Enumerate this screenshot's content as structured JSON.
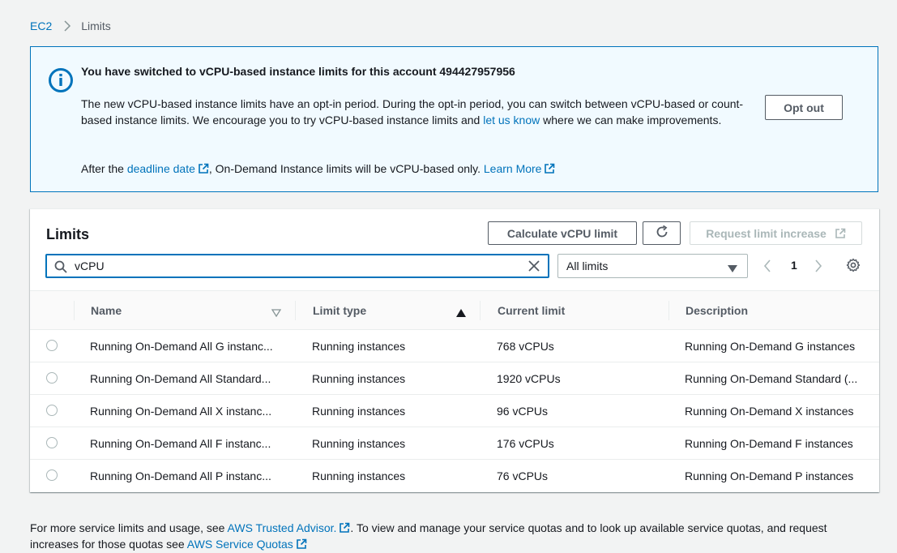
{
  "breadcrumb": {
    "root": "EC2",
    "current": "Limits"
  },
  "banner": {
    "title": "You have switched to vCPU-based instance limits for this account 494427957956",
    "body_part1": "The new vCPU-based instance limits have an opt-in period. During the opt-in period, you can switch between vCPU-based or count-based instance limits. We encourage you to try vCPU-based instance limits and ",
    "body_link": "let us know",
    "body_part2": " where we can make improvements.",
    "foot_part1": "After the ",
    "foot_link1": "deadline date",
    "foot_part2": ", On-Demand Instance limits will be vCPU-based only. ",
    "foot_link2": "Learn More",
    "opt_out_label": "Opt out"
  },
  "panel": {
    "title": "Limits",
    "calc_label": "Calculate vCPU limit",
    "request_label": "Request limit increase",
    "search_value": "vCPU",
    "filter_value": "All limits",
    "page": "1"
  },
  "table": {
    "columns": [
      "Name",
      "Limit type",
      "Current limit",
      "Description"
    ],
    "rows": [
      {
        "name": "Running On-Demand All G instanc...",
        "type": "Running instances",
        "limit": "768 vCPUs",
        "desc": "Running On-Demand G instances"
      },
      {
        "name": "Running On-Demand All Standard...",
        "type": "Running instances",
        "limit": "1920 vCPUs",
        "desc": "Running On-Demand Standard (..."
      },
      {
        "name": "Running On-Demand All X instanc...",
        "type": "Running instances",
        "limit": "96 vCPUs",
        "desc": "Running On-Demand X instances"
      },
      {
        "name": "Running On-Demand All F instanc...",
        "type": "Running instances",
        "limit": "176 vCPUs",
        "desc": "Running On-Demand F instances"
      },
      {
        "name": "Running On-Demand All P instanc...",
        "type": "Running instances",
        "limit": "76 vCPUs",
        "desc": "Running On-Demand P instances"
      }
    ]
  },
  "footer": {
    "part1": "For more service limits and usage, see ",
    "link1": "AWS Trusted Advisor.",
    "part2": ". To view and manage your service quotas and to look up available service quotas, and request increases for those quotas see ",
    "link2": "AWS Service Quotas"
  },
  "colors": {
    "link": "#0073bb",
    "banner_bg": "#f1faff",
    "border": "#eaeded"
  },
  "icons": [
    "chevron-right-icon",
    "info-icon",
    "external-link-icon",
    "refresh-icon",
    "search-icon",
    "close-icon",
    "caret-down-icon",
    "chevron-left-icon",
    "gear-icon",
    "sort-icon"
  ]
}
